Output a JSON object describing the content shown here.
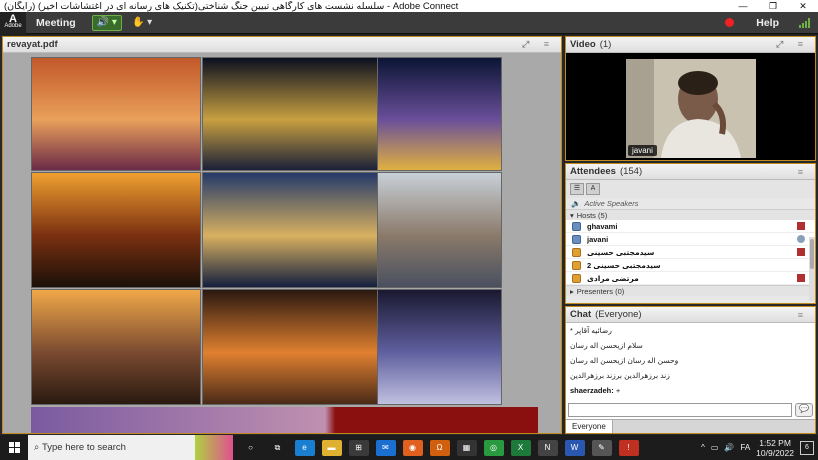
{
  "window": {
    "title": "(رایگان) سلسله نشست های کارگاهی تبیین جنگ شناختی(تکنیک های رسانه ای در اغتشاشات اخیر) - Adobe Connect",
    "controls": [
      "—",
      "❐",
      "✕"
    ]
  },
  "menubar": {
    "logo_mark": "A",
    "logo_text": "Adobe",
    "meeting": "Meeting",
    "help": "Help",
    "speaker_icon": "🔊",
    "raise_hand_icon": "✋"
  },
  "share": {
    "title": "revayat.pdf",
    "tiles": [
      {
        "name": "nasir-ol-molk-mosque",
        "colors": [
          "#c2582a",
          "#e9a05a",
          "#6b2a48"
        ]
      },
      {
        "name": "yazd-amir-chakhmaq-night",
        "colors": [
          "#0b1020",
          "#c8a040",
          "#1a2038"
        ]
      },
      {
        "name": "shrine-night-sky",
        "colors": [
          "#0b1535",
          "#6a4f9a",
          "#e0b040"
        ]
      },
      {
        "name": "sunset-shipwreck",
        "colors": [
          "#f0a030",
          "#7a3010",
          "#1a1008"
        ]
      },
      {
        "name": "sheikh-lotfollah-mosque",
        "colors": [
          "#243a6a",
          "#d8b060",
          "#142040"
        ]
      },
      {
        "name": "desert-kaluts",
        "colors": [
          "#c8d0d8",
          "#8a7a6a",
          "#4a5060"
        ]
      },
      {
        "name": "ecolodge-water-sunset",
        "colors": [
          "#f0a848",
          "#7a4a30",
          "#2a1a10"
        ]
      },
      {
        "name": "bagh-eram-night",
        "colors": [
          "#2a1810",
          "#e08030",
          "#4a2a18"
        ]
      },
      {
        "name": "clock-tower-night",
        "colors": [
          "#1a1830",
          "#6060a0",
          "#c0c0e0"
        ]
      }
    ]
  },
  "video": {
    "title": "Video",
    "count": "(1)",
    "participant": "javani"
  },
  "attendees": {
    "title": "Attendees",
    "count": "(154)",
    "active_speakers": "Active Speakers",
    "hosts_label": "Hosts (5)",
    "presenters_label": "Presenters (0)",
    "rows": [
      {
        "name": "ghavami",
        "role": "host",
        "status": "edit"
      },
      {
        "name": "javani",
        "role": "host",
        "status": "mic"
      },
      {
        "name": "سیدمجتبی حسینی",
        "role": "participant",
        "status": "edit"
      },
      {
        "name": "سیدمجتبی حسینی 2",
        "role": "participant",
        "status": "none"
      },
      {
        "name": "مرتضی مرادی",
        "role": "participant",
        "status": "edit"
      }
    ]
  },
  "chat": {
    "title": "Chat",
    "audience": "(Everyone)",
    "messages": [
      "* رضائیه آقاپر",
      "سلام ازیحسن اله رسان",
      "وحسن اله رسان ازیحسن اله رسان",
      "زند برزهرالدین برزند برزهرالدین"
    ],
    "last_sender": "shaerzadeh:",
    "last_message": "+",
    "input_placeholder": "",
    "tab": "Everyone"
  },
  "taskbar": {
    "search_placeholder": "Type here to search",
    "time": "1:52 PM",
    "date": "10/9/2022",
    "lang": "FA",
    "notifications": "6",
    "apps": [
      {
        "name": "cortana",
        "color": "#1c1c1c",
        "glyph": "○"
      },
      {
        "name": "task-view",
        "color": "#1c1c1c",
        "glyph": "⧉"
      },
      {
        "name": "edge",
        "color": "#1a7fd0",
        "glyph": "e"
      },
      {
        "name": "file-explorer",
        "color": "#e0b030",
        "glyph": "▬"
      },
      {
        "name": "store",
        "color": "#3a3a3a",
        "glyph": "⊞"
      },
      {
        "name": "mail",
        "color": "#1a6fd0",
        "glyph": "✉"
      },
      {
        "name": "firefox",
        "color": "#e06020",
        "glyph": "◉"
      },
      {
        "name": "app-orange",
        "color": "#d06010",
        "glyph": "Ω"
      },
      {
        "name": "calculator",
        "color": "#333",
        "glyph": "▦"
      },
      {
        "name": "chrome",
        "color": "#2a9a40",
        "glyph": "◎"
      },
      {
        "name": "excel",
        "color": "#1d7a3a",
        "glyph": "X"
      },
      {
        "name": "onenote",
        "color": "#444",
        "glyph": "N"
      },
      {
        "name": "word",
        "color": "#2a58b0",
        "glyph": "W"
      },
      {
        "name": "paint",
        "color": "#555",
        "glyph": "✎"
      },
      {
        "name": "app-red",
        "color": "#c03020",
        "glyph": "!"
      }
    ]
  }
}
